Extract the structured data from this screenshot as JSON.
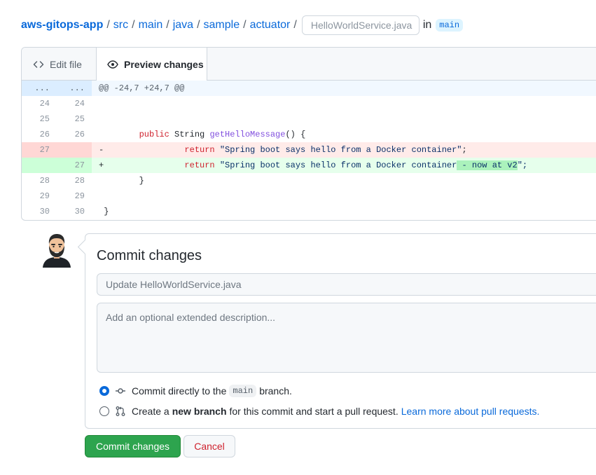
{
  "breadcrumb": {
    "repo": "aws-gitops-app",
    "dirs": [
      "src",
      "main",
      "java",
      "sample",
      "actuator"
    ],
    "separator": "/",
    "filename": "HelloWorldService.java",
    "in_text": "in",
    "branch": "main"
  },
  "tabs": {
    "edit": "Edit file",
    "preview": "Preview changes"
  },
  "diff": {
    "hunk": {
      "left": "...",
      "right": "...",
      "text": "@@ -24,7 +24,7 @@"
    },
    "rows": [
      {
        "left": "24",
        "right": "24"
      },
      {
        "left": "25",
        "right": "25"
      },
      {
        "left": "26",
        "right": "26",
        "indent": "        ",
        "kw": "public",
        "mid": " String ",
        "fn": "getHelloMessage",
        "rest": "() {"
      },
      {
        "left": "27",
        "right": "",
        "marker": "-",
        "indent": "                ",
        "kw": "return",
        "str": " \"Spring boot says hello from a Docker container\"",
        "end": ";"
      },
      {
        "left": "",
        "right": "27",
        "marker": "+",
        "indent": "                ",
        "kw": "return",
        "str": " \"Spring boot says hello from a Docker container",
        "added": " - now at v2",
        "end": "\";"
      },
      {
        "left": "28",
        "right": "28",
        "text": "        }"
      },
      {
        "left": "29",
        "right": "29"
      },
      {
        "left": "30",
        "right": "30",
        "text": " }"
      }
    ]
  },
  "commit": {
    "title": "Commit changes",
    "summary_placeholder": "Update HelloWorldService.java",
    "description_placeholder": "Add an optional extended description...",
    "option_direct": {
      "before": "Commit directly to the",
      "branch": "main",
      "after": "branch."
    },
    "option_new": {
      "before": "Create a",
      "bold": "new branch",
      "after": "for this commit and start a pull request.",
      "link": "Learn more about pull requests."
    }
  },
  "buttons": {
    "commit": "Commit changes",
    "cancel": "Cancel"
  },
  "colors": {
    "link": "#0969da",
    "primary": "#2da44e",
    "danger": "#cf222e",
    "deleted_bg": "#ffebe9",
    "added_bg": "#e6ffec"
  },
  "icons": {
    "edit_tab": "code-icon",
    "preview_tab": "eye-icon",
    "direct_commit": "git-commit-icon",
    "new_branch": "git-pull-request-icon"
  }
}
